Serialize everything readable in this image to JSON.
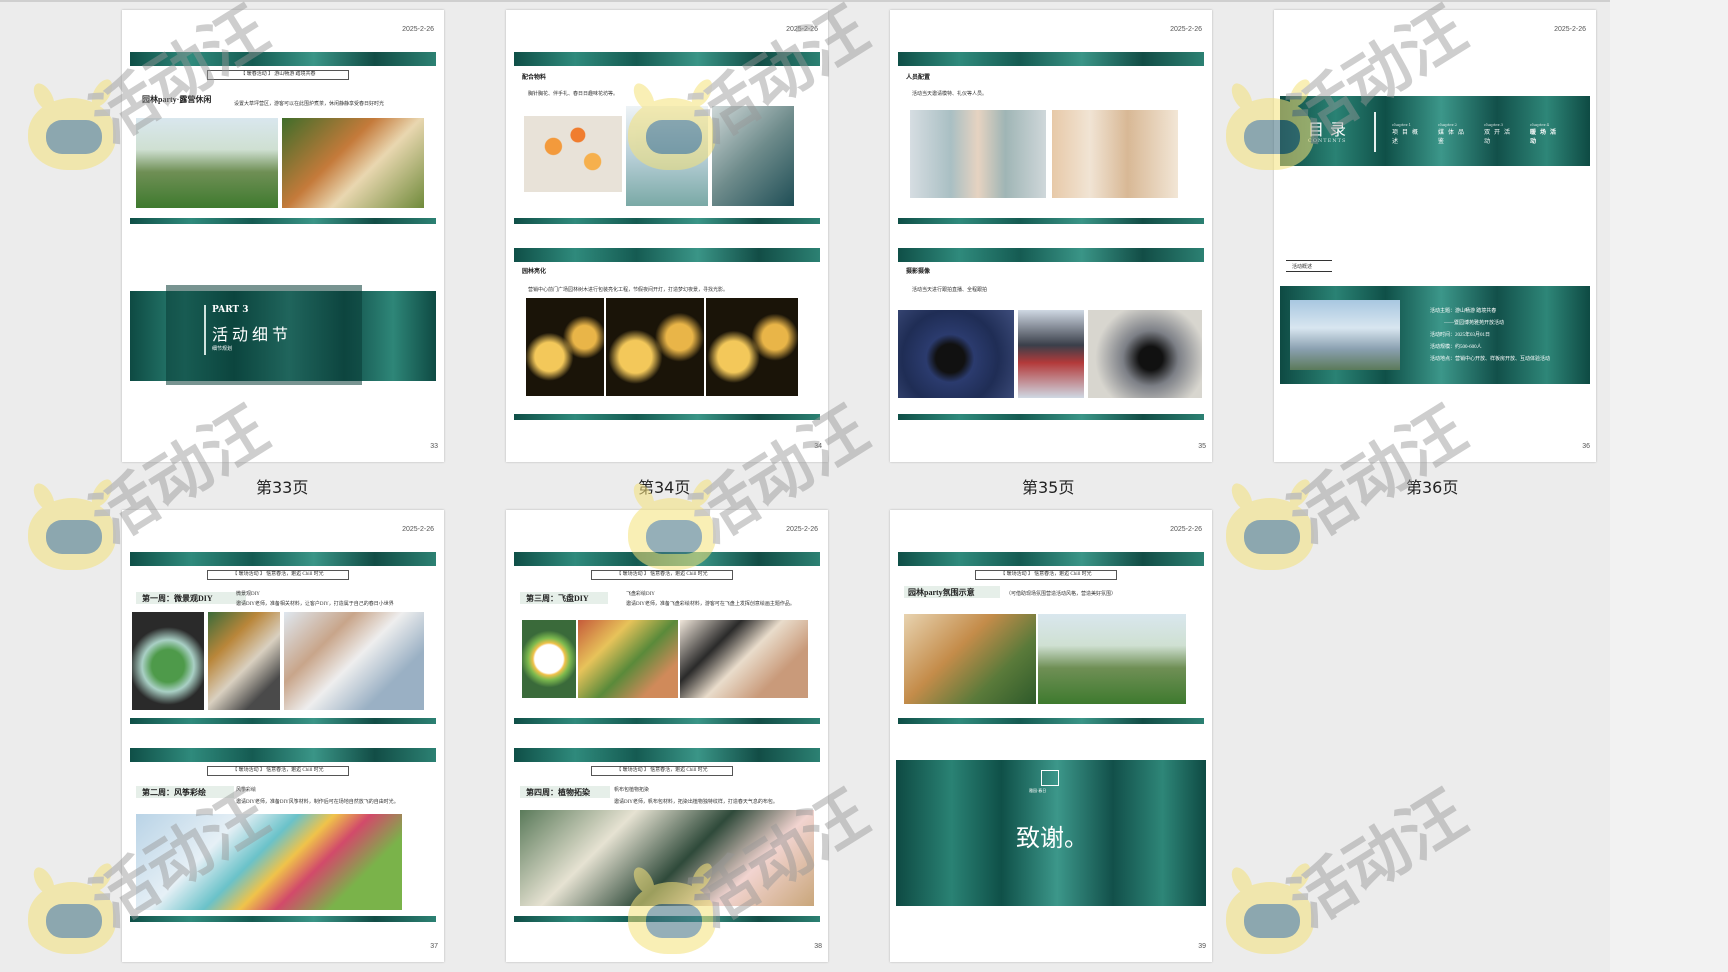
{
  "watermark": {
    "text": "活动汪"
  },
  "pages": [
    {
      "date": "2025-2-26",
      "page_number": "33",
      "caption": "第33页",
      "kicker": "【 暖春活动 】 游山畅游 踏境共春",
      "section": "园林party·露营休闲",
      "desc": "设置大草坪营区，游客可以在此围炉煮茶，休闲静静享受春日好时光",
      "part_label": "PART 3",
      "part_title": "活动细节",
      "part_sub": "细节规划"
    },
    {
      "date": "2025-2-26",
      "page_number": "34",
      "caption": "第34页",
      "section1": "配合物料",
      "desc1": "胸针胸花、伴手礼、春日日趣味花坊等。",
      "section2": "园林亮化",
      "desc2": "营销中心前门广场园林树木进行包装亮化工程，节假夜间开灯，打造梦幻夜景，寻找光影。"
    },
    {
      "date": "2025-2-26",
      "page_number": "35",
      "caption": "第35页",
      "section1": "人员配置",
      "desc1": "活动当天邀请模特、礼仪等人员。",
      "section2": "摄影摄像",
      "desc2": "活动当天进行跟拍直播、全程跟拍"
    },
    {
      "date": "2025-2-26",
      "page_number": "36",
      "caption": "第36页",
      "toc_title": "目录",
      "toc_sub": "CONTENTS",
      "toc_items": [
        {
          "chapter": "chapter.1",
          "label": "项目概述"
        },
        {
          "chapter": "chapter.2",
          "label": "媒体品鉴"
        },
        {
          "chapter": "chapter.3",
          "label": "双开活动"
        },
        {
          "chapter": "chapter.4",
          "label": "暖场活动"
        }
      ],
      "tag": "活动概述",
      "info": [
        "活动主题：游山畅游 踏境共春",
        "——暨园博苑雅苑开放活动",
        "活动时间：2025年03月01日",
        "活动规模：约500-600人",
        "活动地点：营销中心开放、样板房开放、互动体验活动"
      ]
    },
    {
      "date": "2025-2-26",
      "page_number": "37",
      "kicker": "【 暖场活动 】 惬意春活，邂逅 Chill 时光",
      "section1": "第一周：微景观DIY",
      "desc1a": "微景观DIY",
      "desc1b": "邀请DIY老师，准备相关材料，让客户DIY，打造属于自己的春日小世界",
      "section2": "第二周：风筝彩绘",
      "desc2a": "风筝彩绘",
      "desc2b": "邀请DIY老师，准备DIY风筝材料，制作后可在场地自然放飞的自由时光。"
    },
    {
      "date": "2025-2-26",
      "page_number": "38",
      "kicker": "【 暖场活动 】 惬意春活，邂逅 Chill 时光",
      "section1": "第三周：飞盘DIY",
      "desc1a": "飞盘彩绘DIY",
      "desc1b": "邀请DIY老师，准备飞盘彩绘材料，游客可在飞盘上发挥创意绘画主题作品。",
      "section2": "第四周：植物拓染",
      "desc2a": "帆布包植物拓染",
      "desc2b": "邀请DIY老师，帆布包材料，拓染出植物独特纹样，打造春天气息的布包。"
    },
    {
      "date": "2025-2-26",
      "page_number": "39",
      "kicker": "【 暖场活动 】 惬意春活，邂逅 Chill 时光",
      "section": "园林party氛围示意",
      "note": "（可借助现场氛围营造活动风格，营造美好氛围）",
      "thanks": "致谢。",
      "logo_line": "雅园·春日"
    }
  ]
}
